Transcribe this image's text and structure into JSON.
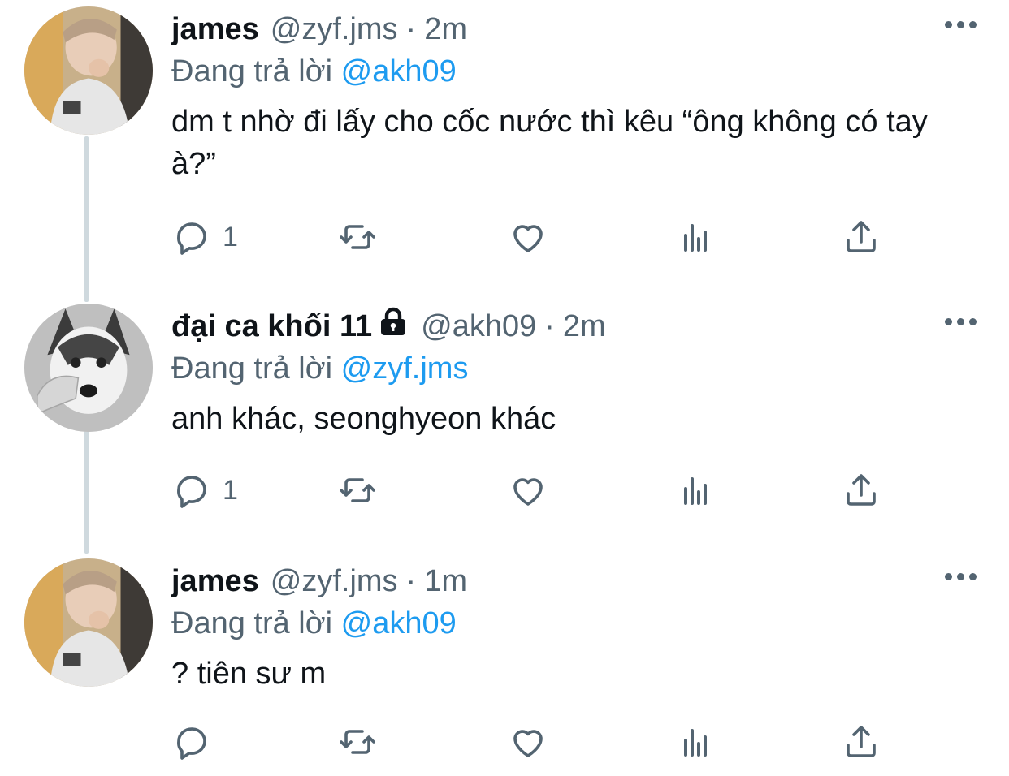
{
  "colors": {
    "text_primary": "#0f1419",
    "text_secondary": "#536471",
    "mention": "#1d9bf0",
    "thread_line": "#cfd9de"
  },
  "tweets": [
    {
      "display_name": "james",
      "handle": "@zyf.jms",
      "separator": "·",
      "time": "2m",
      "reply_prefix": "Đang trả lời",
      "reply_to": "@akh09",
      "text": "dm t nhờ đi lấy cho cốc nước thì kêu “ông không có tay à?”",
      "reply_count": "1",
      "locked": false,
      "avatar": "avatar-photo-james"
    },
    {
      "display_name": "đại ca khối 11",
      "handle": "@akh09",
      "separator": "·",
      "time": "2m",
      "reply_prefix": "Đang trả lời",
      "reply_to": "@zyf.jms",
      "text": "anh khác, seonghyeon khác",
      "reply_count": "1",
      "locked": true,
      "avatar": "avatar-photo-husky"
    },
    {
      "display_name": "james",
      "handle": "@zyf.jms",
      "separator": "·",
      "time": "1m",
      "reply_prefix": "Đang trả lời",
      "reply_to": "@akh09",
      "text": "? tiên sư m",
      "reply_count": "",
      "locked": false,
      "avatar": "avatar-photo-james"
    }
  ],
  "icons": {
    "reply": "reply-bubble-icon",
    "retweet": "retweet-icon",
    "like": "heart-icon",
    "views": "views-bar-chart-icon",
    "share": "share-upload-icon",
    "more": "more-dots-icon",
    "lock": "lock-icon"
  }
}
